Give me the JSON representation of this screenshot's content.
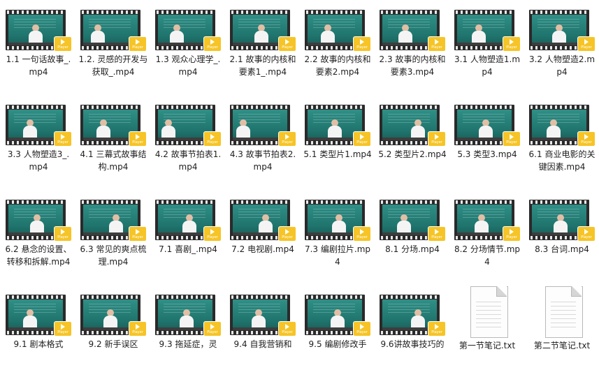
{
  "files": [
    {
      "name": "1.1 一句话故事_.mp4",
      "type": "video",
      "icon": "video-file-icon",
      "badge": "Player"
    },
    {
      "name": "1.2. 灵感的开发与获取_.mp4",
      "type": "video",
      "icon": "video-file-icon",
      "badge": "Player"
    },
    {
      "name": "1.3 观众心理学_.mp4",
      "type": "video",
      "icon": "video-file-icon",
      "badge": "Player"
    },
    {
      "name": "2.1 故事的内核和要素1_.mp4",
      "type": "video",
      "icon": "video-file-icon",
      "badge": "Player"
    },
    {
      "name": "2.2 故事的内核和要素2.mp4",
      "type": "video",
      "icon": "video-file-icon",
      "badge": "Player"
    },
    {
      "name": "2.3 故事的内核和要素3.mp4",
      "type": "video",
      "icon": "video-file-icon",
      "badge": "Player"
    },
    {
      "name": "3.1 人物塑造1.mp4",
      "type": "video",
      "icon": "video-file-icon",
      "badge": "Player"
    },
    {
      "name": "3.2 人物塑造2.mp4",
      "type": "video",
      "icon": "video-file-icon",
      "badge": "Player"
    },
    {
      "name": "3.3 人物塑造3_.mp4",
      "type": "video",
      "icon": "video-file-icon",
      "badge": "Player"
    },
    {
      "name": "4.1 三幕式故事结构.mp4",
      "type": "video",
      "icon": "video-file-icon",
      "badge": "Player"
    },
    {
      "name": "4.2 故事节拍表1.mp4",
      "type": "video",
      "icon": "video-file-icon",
      "badge": "Player"
    },
    {
      "name": "4.3 故事节拍表2.mp4",
      "type": "video",
      "icon": "video-file-icon",
      "badge": "Player"
    },
    {
      "name": "5.1 类型片1.mp4",
      "type": "video",
      "icon": "video-file-icon",
      "badge": "Player"
    },
    {
      "name": "5.2 类型片2.mp4",
      "type": "video",
      "icon": "video-file-icon",
      "badge": "Player"
    },
    {
      "name": "5.3 类型3.mp4",
      "type": "video",
      "icon": "video-file-icon",
      "badge": "Player"
    },
    {
      "name": "6.1 商业电影的关键因素.mp4",
      "type": "video",
      "icon": "video-file-icon",
      "badge": "Player"
    },
    {
      "name": "6.2 悬念的设置、转移和拆解.mp4",
      "type": "video",
      "icon": "video-file-icon",
      "badge": "Player"
    },
    {
      "name": "6.3 常见的爽点梳理.mp4",
      "type": "video",
      "icon": "video-file-icon",
      "badge": "Player"
    },
    {
      "name": "7.1 喜剧_.mp4",
      "type": "video",
      "icon": "video-file-icon",
      "badge": "Player"
    },
    {
      "name": "7.2 电视剧.mp4",
      "type": "video",
      "icon": "video-file-icon",
      "badge": "Player"
    },
    {
      "name": "7.3 编剧拉片.mp4",
      "type": "video",
      "icon": "video-file-icon",
      "badge": "Player"
    },
    {
      "name": "8.1 分场.mp4",
      "type": "video",
      "icon": "video-file-icon",
      "badge": "Player"
    },
    {
      "name": "8.2 分场情节.mp4",
      "type": "video",
      "icon": "video-file-icon",
      "badge": "Player"
    },
    {
      "name": "8.3 台词.mp4",
      "type": "video",
      "icon": "video-file-icon",
      "badge": "Player"
    },
    {
      "name": "9.1 剧本格式",
      "type": "video",
      "icon": "video-file-icon",
      "badge": "Player"
    },
    {
      "name": "9.2 新手误区",
      "type": "video",
      "icon": "video-file-icon",
      "badge": "Player"
    },
    {
      "name": "9.3 拖延症，灵",
      "type": "video",
      "icon": "video-file-icon",
      "badge": "Player"
    },
    {
      "name": "9.4 自我营销和",
      "type": "video",
      "icon": "video-file-icon",
      "badge": "Player"
    },
    {
      "name": "9.5 编剧修改手",
      "type": "video",
      "icon": "video-file-icon",
      "badge": "Player"
    },
    {
      "name": "9.6讲故事技巧的",
      "type": "video",
      "icon": "video-file-icon",
      "badge": "Player"
    },
    {
      "name": "第一节笔记.txt",
      "type": "document",
      "icon": "text-document-icon",
      "badge": ""
    },
    {
      "name": "第二节笔记.txt",
      "type": "document",
      "icon": "text-document-icon",
      "badge": ""
    }
  ],
  "colors": {
    "background": "#ffffff",
    "film_strip": "#2a2a2a",
    "chalkboard": "#2f8f86",
    "badge": "#f6c426",
    "label_text": "#1f1f1f"
  }
}
